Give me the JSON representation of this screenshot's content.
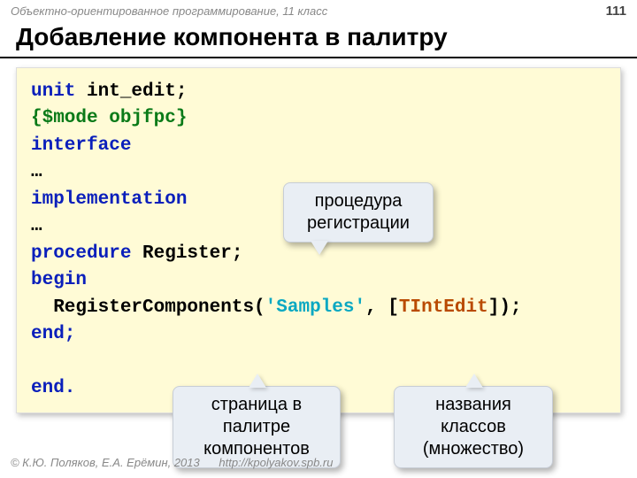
{
  "header": {
    "course": "Объектно-ориентированное программирование, 11 класс",
    "page": "111"
  },
  "title": "Добавление компонента в палитру",
  "code": {
    "l1a": "unit",
    "l1b": " int_edit;",
    "l2": "{$mode objfpc}",
    "l3": "interface",
    "l4": "…",
    "l5": "implementation",
    "l6": "…",
    "l7a": "procedure",
    "l7b": " Register;",
    "l8": "begin",
    "l9a": "  RegisterComponents(",
    "l9b": "'Samples'",
    "l9c": ", [",
    "l9d": "TIntEdit",
    "l9e": "]);",
    "l10": "end;",
    "l11": "",
    "l12": "end."
  },
  "callouts": {
    "c1": "процедура\nрегистрации",
    "c2": "страница в\nпалитре\nкомпонентов",
    "c3": "названия\nклассов\n(множество)"
  },
  "footer": {
    "copyright": "© К.Ю. Поляков, Е.А. Ерёмин, 2013",
    "url": "http://kpolyakov.spb.ru"
  }
}
